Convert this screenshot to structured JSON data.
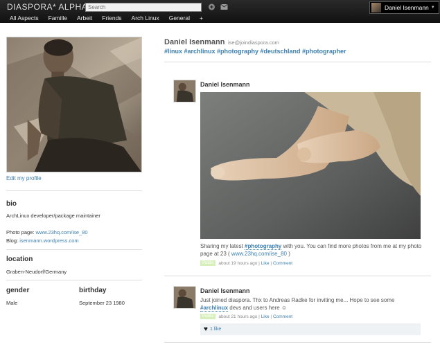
{
  "header": {
    "brand": "DIASPORA* ALPHA",
    "search_placeholder": "Search",
    "user_name": "Daniel Isenmann"
  },
  "aspects": [
    "All Aspects",
    "Famille",
    "Arbeit",
    "Friends",
    "Arch Linux",
    "General",
    "+"
  ],
  "sidebar": {
    "edit_profile": "Edit my profile",
    "bio_title": "bio",
    "bio_text": "ArchLinux developer/package maintainer",
    "photo_label": "Photo page:",
    "photo_url": "www.23hq.com/ise_80",
    "blog_label": "Blog:",
    "blog_url": "isenmann.wordpress.com",
    "location_title": "location",
    "location_text": "Graben-Neudorf/Germany",
    "gender_title": "gender",
    "gender_text": "Male",
    "birthday_title": "birthday",
    "birthday_text": "September 23 1980"
  },
  "profile": {
    "name": "Daniel Isenmann",
    "handle": "ise@joindiaspora.com",
    "tags": "#linux #archlinux #photography #deutschland #photographer"
  },
  "posts": [
    {
      "author": "Daniel Isenmann",
      "text_before": "Sharing my latest ",
      "tag": "#photography",
      "text_after": " with you. You can find more photos from me at my photo page at 23 ( ",
      "link": "www.23hq.com/ise_80",
      "text_end": " )",
      "badge": "Public",
      "time": "about 19 hours ago",
      "like": "Like",
      "comment": "Comment"
    },
    {
      "author": "Daniel Isenmann",
      "text_before": "Just joined diaspora. Thx to Andreas Radke for inviting me... Hope to see some ",
      "tag": "#archlinux",
      "text_after": " devs and users here ☺",
      "badge": "Public",
      "time": "about 21 hours ago",
      "like": "Like",
      "comment": "Comment",
      "likes_count": "1 like"
    }
  ],
  "colors": {
    "link": "#3b7fb0",
    "header_bg": "#1a1a1a"
  }
}
